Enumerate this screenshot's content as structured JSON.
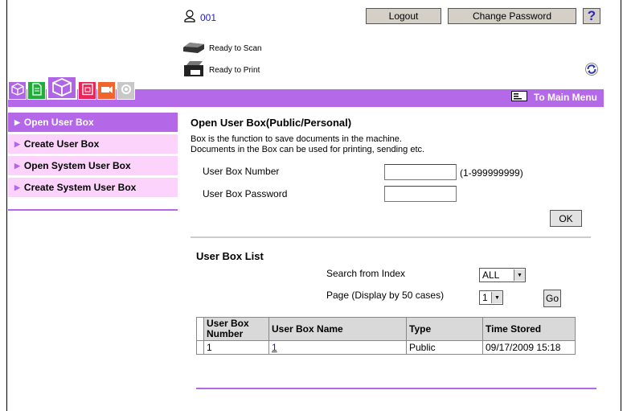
{
  "header": {
    "user_name": "001",
    "logout_label": "Logout",
    "change_password_label": "Change Password",
    "help_label": "?"
  },
  "status": {
    "scan": "Ready to Scan",
    "print": "Ready to Print"
  },
  "menubar": {
    "main_menu_label": "To Main Menu"
  },
  "sidebar": {
    "items": [
      {
        "label": "Open User Box",
        "active": true
      },
      {
        "label": "Create User Box",
        "active": false
      },
      {
        "label": "Open System User Box",
        "active": false
      },
      {
        "label": "Create System User Box",
        "active": false
      }
    ]
  },
  "open_box": {
    "title": "Open User Box(Public/Personal)",
    "desc_line1": "Box is the function to save documents in the machine.",
    "desc_line2": "Documents in the Box can be used for printing, sending etc.",
    "number_label": "User Box Number",
    "number_range": "(1-999999999)",
    "number_value": "",
    "password_label": "User Box Password",
    "password_value": "",
    "ok_label": "OK"
  },
  "box_list": {
    "title": "User Box List",
    "search_label": "Search from Index",
    "search_value": "ALL",
    "page_label": "Page (Display by 50 cases)",
    "page_value": "1",
    "go_label": "Go",
    "columns": [
      "User Box Number",
      "User Box Name",
      "Type",
      "Time Stored"
    ],
    "rows": [
      {
        "number": "1",
        "name": "1",
        "type": "Public",
        "time": "09/17/2009 15:18"
      }
    ]
  },
  "colors": {
    "accent": "#b369e8",
    "sidebar_bg": "#fbd3fb",
    "link": "#2020c0"
  }
}
